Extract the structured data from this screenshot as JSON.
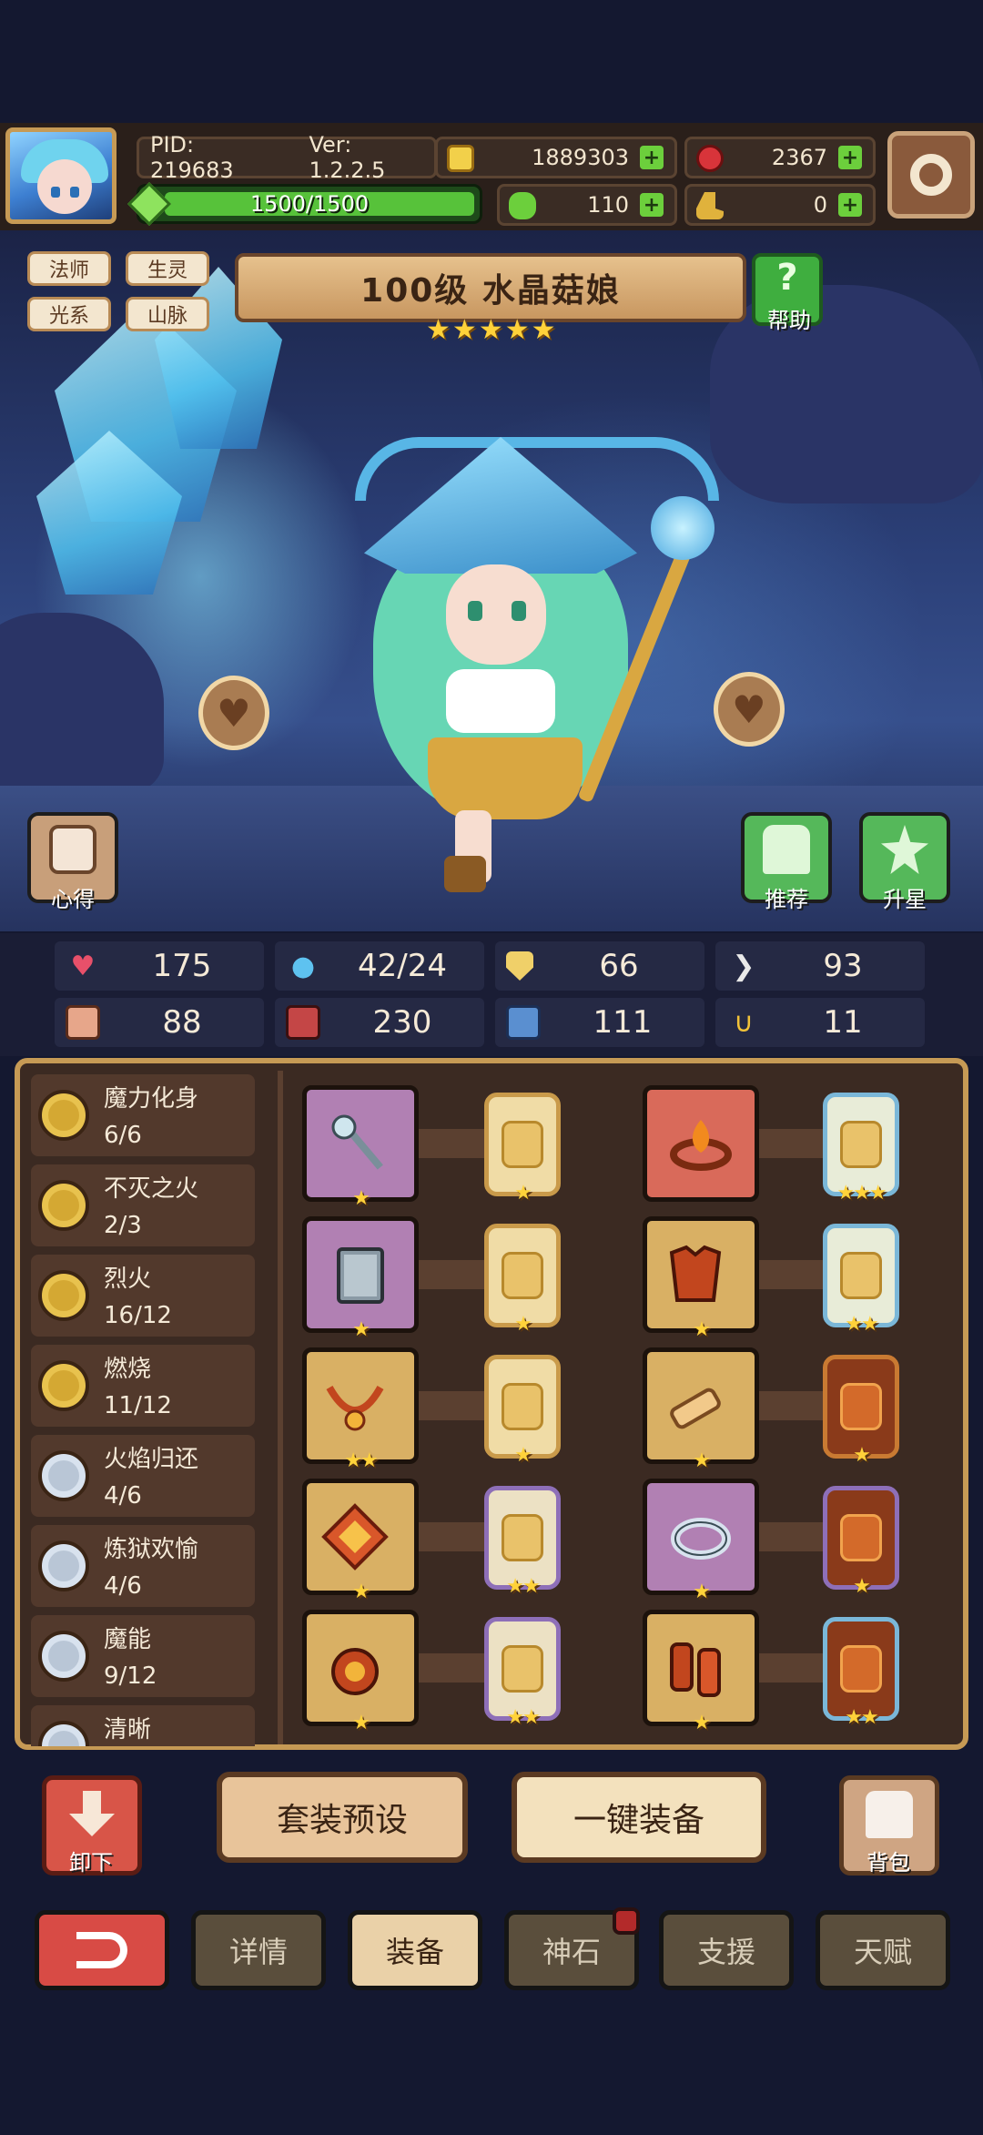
{
  "top_bar": {
    "pid": "PID: 219683",
    "version": "Ver: 1.2.2.5",
    "gold": "1889303",
    "rubies": "2367",
    "clovers": "110",
    "boots": "0",
    "exp": "1500/1500"
  },
  "hero": {
    "tags": [
      "法师",
      "生灵",
      "光系",
      "山脉"
    ],
    "title": "100级 水晶菇娘",
    "stars": 5,
    "help_label": "帮助",
    "insight_label": "心得",
    "recommend_label": "推荐",
    "upgrade_star_label": "升星"
  },
  "stats": {
    "hp": "175",
    "mana": "42/24",
    "defense": "66",
    "speed": "93",
    "attack": "88",
    "magic": "230",
    "resist": "111",
    "luck": "11"
  },
  "set_bonuses": [
    {
      "name": "魔力化身",
      "progress": "6/6",
      "tier": "gold"
    },
    {
      "name": "不灭之火",
      "progress": "2/3",
      "tier": "gold"
    },
    {
      "name": "烈火",
      "progress": "16/12",
      "tier": "gold"
    },
    {
      "name": "燃烧",
      "progress": "11/12",
      "tier": "gold"
    },
    {
      "name": "火焰归还",
      "progress": "4/6",
      "tier": "silver"
    },
    {
      "name": "炼狱欢愉",
      "progress": "4/6",
      "tier": "silver"
    },
    {
      "name": "魔能",
      "progress": "9/12",
      "tier": "silver"
    },
    {
      "name": "清晰",
      "progress": "",
      "tier": "silver"
    }
  ],
  "equipment": {
    "left_column": [
      {
        "item": "staff-icon",
        "rarity": "purple",
        "item_stars": "★",
        "card": "gold",
        "card_stars": "★"
      },
      {
        "item": "book-icon",
        "rarity": "purple",
        "item_stars": "★",
        "card": "gold",
        "card_stars": "★"
      },
      {
        "item": "amulet-icon",
        "rarity": "gold",
        "item_stars": "★★",
        "card": "gold",
        "card_stars": "★"
      },
      {
        "item": "gem-icon",
        "rarity": "gold",
        "item_stars": "★",
        "card": "violet",
        "card_stars": "★★"
      },
      {
        "item": "gauntlet-icon",
        "rarity": "gold",
        "item_stars": "★",
        "card": "violet",
        "card_stars": "★★"
      }
    ],
    "right_column": [
      {
        "item": "fire-ring-icon",
        "rarity": "red",
        "item_stars": "",
        "card": "blue",
        "card_stars": "★★★"
      },
      {
        "item": "armor-icon",
        "rarity": "gold",
        "item_stars": "★",
        "card": "blue",
        "card_stars": "★★"
      },
      {
        "item": "bracer-icon",
        "rarity": "gold",
        "item_stars": "★",
        "card": "orange",
        "card_stars": "★"
      },
      {
        "item": "ring-icon",
        "rarity": "purple",
        "item_stars": "★",
        "card": "orange-violet",
        "card_stars": "★"
      },
      {
        "item": "boots-icon",
        "rarity": "gold",
        "item_stars": "★",
        "card": "orange-blue",
        "card_stars": "★★"
      }
    ]
  },
  "actions": {
    "unequip_label": "卸下",
    "preset_label": "套装预设",
    "equip_all_label": "一键装备",
    "bag_label": "背包"
  },
  "nav": {
    "tabs": [
      "详情",
      "装备",
      "神石",
      "支援",
      "天赋"
    ],
    "active": "装备"
  },
  "colors": {
    "background": "#141830",
    "panel": "#3b2a22",
    "panel_border": "#c69a55",
    "exp_green": "#57c23a",
    "back_red": "#d84b45",
    "star_gold": "#ffd23a"
  }
}
